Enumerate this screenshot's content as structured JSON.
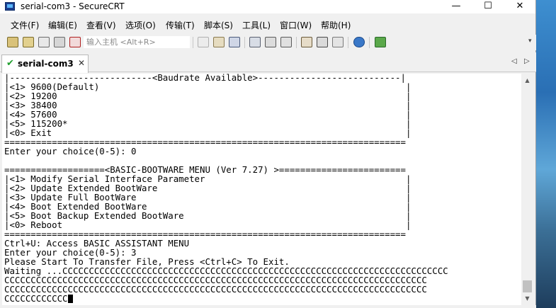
{
  "window": {
    "title": "serial-com3 - SecureCRT",
    "minimize": "—",
    "maximize": "☐",
    "close": "✕"
  },
  "menu": [
    "文件(F)",
    "编辑(E)",
    "查看(V)",
    "选项(O)",
    "传输(T)",
    "脚本(S)",
    "工具(L)",
    "窗口(W)",
    "帮助(H)"
  ],
  "toolbar": {
    "quick_connect_placeholder": "输入主机 <Alt+R>",
    "overflow": "▾"
  },
  "tabs": [
    {
      "label": "serial-com3",
      "status": "✔",
      "close": "✕"
    }
  ],
  "tab_nav": {
    "prev": "◁",
    "next": "▷"
  },
  "terminal": {
    "lines": [
      "|---------------------------<Baudrate Available>---------------------------|",
      "|<1> 9600(Default)                                                          |",
      "|<2> 19200                                                                  |",
      "|<3> 38400                                                                  |",
      "|<4> 57600                                                                  |",
      "|<5> 115200*                                                                |",
      "|<0> Exit                                                                   |",
      "============================================================================",
      "Enter your choice(0-5): 0",
      "",
      "===================<BASIC-BOOTWARE MENU (Ver 7.27) >========================",
      "|<1> Modify Serial Interface Parameter                                      |",
      "|<2> Update Extended BootWare                                               |",
      "|<3> Update Full BootWare                                                   |",
      "|<4> Boot Extended BootWare                                                 |",
      "|<5> Boot Backup Extended BootWare                                          |",
      "|<0> Reboot                                                                 |",
      "============================================================================",
      "Ctrl+U: Access BASIC ASSISTANT MENU",
      "Enter your choice(0-5): 3",
      "Please Start To Transfer File, Press <Ctrl+C> To Exit.",
      "Waiting ...CCCCCCCCCCCCCCCCCCCCCCCCCCCCCCCCCCCCCCCCCCCCCCCCCCCCCCCCCCCCCCCCCCCCCCCCC",
      "CCCCCCCCCCCCCCCCCCCCCCCCCCCCCCCCCCCCCCCCCCCCCCCCCCCCCCCCCCCCCCCCCCCCCCCCCCCCCCCC",
      "CCCCCCCCCCCCCCCCCCCCCCCCCCCCCCCCCCCCCCCCCCCCCCCCCCCCCCCCCCCCCCCCCCCCCCCCCCCCCCCC"
    ],
    "last_line": "CCCCCCCCCCCC"
  },
  "scrollbar": {
    "up": "▲",
    "down": "▼"
  }
}
